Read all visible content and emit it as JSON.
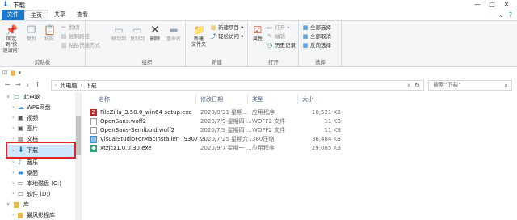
{
  "window": {
    "title": "下载",
    "minimize": "—",
    "maximize": "□",
    "close": "✕"
  },
  "tabs": [
    "文件",
    "主页",
    "共享",
    "查看"
  ],
  "ribbon": {
    "clipboard": {
      "label": "剪贴板",
      "pin": "固定到\"快\n速访问\"",
      "copy": "复制",
      "paste": "粘贴",
      "cut": "剪切",
      "copy_path": "复制路径",
      "paste_shortcut": "粘贴快捷方式"
    },
    "organize": {
      "label": "组织",
      "move_to": "移动到",
      "copy_to": "复制到",
      "delete": "删除",
      "rename": "重命名"
    },
    "new": {
      "label": "新建",
      "new_folder": "新建\n文件夹",
      "new_item": "新建项目",
      "easy_access": "轻松访问"
    },
    "open": {
      "label": "打开",
      "properties": "属性",
      "open": "打开",
      "edit": "编辑",
      "history": "历史记录"
    },
    "select": {
      "label": "选择",
      "select_all": "全部选择",
      "select_none": "全部取消",
      "invert": "反向选择"
    }
  },
  "address": {
    "crumbs": [
      "此电脑",
      "下载"
    ],
    "search_placeholder": "搜索\"下载\""
  },
  "columns": [
    "名称",
    "修改日期",
    "类型",
    "大小"
  ],
  "files": [
    {
      "name": "FileZilla_3.50.0_win64-setup.exe",
      "date": "2020/8/31 星期...",
      "type": "应用程序",
      "size": "10,521 KB",
      "icon": "filezilla-icon",
      "color": "#c0272d"
    },
    {
      "name": "OpenSans.woff2",
      "date": "2020/7/9 星期四 ...",
      "type": "WOFF2 文件",
      "size": "11 KB",
      "icon": "document-icon",
      "color": "#ffffff"
    },
    {
      "name": "OpenSans-Semibold.woff2",
      "date": "2020/7/9 星期四 ...",
      "type": "WOFF2 文件",
      "size": "11 KB",
      "icon": "document-icon",
      "color": "#ffffff"
    },
    {
      "name": "VisualStudioForMacInstaller__930773...",
      "date": "2020/7/25 星期六 ...",
      "type": "360压缩",
      "size": "36,484 KB",
      "icon": "archive-icon",
      "color": "#3b8fd6"
    },
    {
      "name": "xtzjcz1.0.0.30.exe",
      "date": "2020/9/7 星期一 ...",
      "type": "应用程序",
      "size": "29,085 KB",
      "icon": "installer-icon",
      "color": "#2aa57a"
    }
  ],
  "nav": [
    {
      "label": "此电脑",
      "icon": "computer-icon",
      "level": 0,
      "expanded": true
    },
    {
      "label": "WPS网盘",
      "icon": "cloud-icon",
      "level": 1
    },
    {
      "label": "视频",
      "icon": "video-icon",
      "level": 1
    },
    {
      "label": "图片",
      "icon": "picture-icon",
      "level": 1
    },
    {
      "label": "文档",
      "icon": "document-folder-icon",
      "level": 1
    },
    {
      "label": "下载",
      "icon": "download-icon",
      "level": 1,
      "selected": true
    },
    {
      "label": "音乐",
      "icon": "music-icon",
      "level": 1
    },
    {
      "label": "桌面",
      "icon": "desktop-icon",
      "level": 1
    },
    {
      "label": "本地磁盘 (C:)",
      "icon": "drive-icon",
      "level": 1
    },
    {
      "label": "软件 (D:)",
      "icon": "drive-icon",
      "level": 1
    },
    {
      "label": "库",
      "icon": "library-icon",
      "level": 0,
      "expanded": true
    },
    {
      "label": "暴风影视库",
      "icon": "folder-icon",
      "level": 1
    }
  ],
  "colors": {
    "accent": "#1979ca",
    "selection": "#cce8ff",
    "highlight": "#e0262b"
  }
}
